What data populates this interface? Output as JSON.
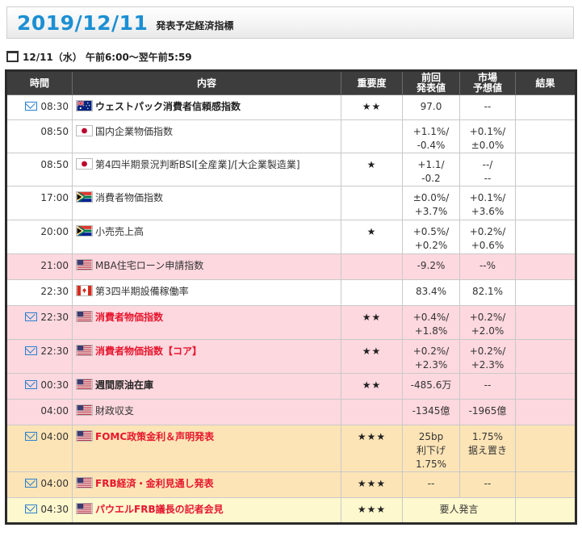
{
  "header": {
    "date": "2019/12/11",
    "subtitle": "発表予定経済指標"
  },
  "dayline": {
    "text": "12/11（水） 午前6:00～翌午前5:59"
  },
  "columns": {
    "time": "時間",
    "content": "内容",
    "importance": "重要度",
    "previous_l1": "前回",
    "previous_l2": "発表値",
    "forecast_l1": "市場",
    "forecast_l2": "予想値",
    "result": "結果"
  },
  "rows": [
    {
      "time": "08:30",
      "mail": true,
      "flag": "australia-flag-icon",
      "name": "ウェストパック消費者信頼感指数",
      "style": "bold",
      "bg": "white",
      "stars": "★★",
      "prev1": "97.0",
      "prev2": "",
      "prev3": "",
      "fore1": "--",
      "fore2": "",
      "result": ""
    },
    {
      "time": "08:50",
      "mail": false,
      "flag": "japan-flag-icon",
      "name": "国内企業物価指数",
      "style": "normal",
      "bg": "white",
      "stars": "",
      "prev1": "+1.1%/",
      "prev2": "-0.4%",
      "prev3": "",
      "fore1": "+0.1%/",
      "fore2": "±0.0%",
      "result": ""
    },
    {
      "time": "08:50",
      "mail": false,
      "flag": "japan-flag-icon",
      "name": "第4四半期景況判断BSI[全産業]/[大企業製造業]",
      "style": "normal",
      "bg": "white",
      "stars": "★",
      "prev1": "+1.1/",
      "prev2": "-0.2",
      "prev3": "",
      "fore1": "--/",
      "fore2": "--",
      "result": ""
    },
    {
      "time": "17:00",
      "mail": false,
      "flag": "south-africa-flag-icon",
      "name": "消費者物価指数",
      "style": "normal",
      "bg": "white",
      "stars": "",
      "prev1": "±0.0%/",
      "prev2": "+3.7%",
      "prev3": "",
      "fore1": "+0.1%/",
      "fore2": "+3.6%",
      "result": ""
    },
    {
      "time": "20:00",
      "mail": false,
      "flag": "south-africa-flag-icon",
      "name": "小売売上高",
      "style": "normal",
      "bg": "white",
      "stars": "★",
      "prev1": "+0.5%/",
      "prev2": "+0.2%",
      "prev3": "",
      "fore1": "+0.2%/",
      "fore2": "+0.6%",
      "result": ""
    },
    {
      "time": "21:00",
      "mail": false,
      "flag": "usa-flag-icon",
      "name": "MBA住宅ローン申請指数",
      "style": "normal",
      "bg": "pink",
      "stars": "",
      "prev1": "-9.2%",
      "prev2": "",
      "prev3": "",
      "fore1": "--%",
      "fore2": "",
      "result": ""
    },
    {
      "time": "22:30",
      "mail": false,
      "flag": "canada-flag-icon",
      "name": "第3四半期設備稼働率",
      "style": "normal",
      "bg": "white",
      "stars": "",
      "prev1": "83.4%",
      "prev2": "",
      "prev3": "",
      "fore1": "82.1%",
      "fore2": "",
      "result": ""
    },
    {
      "time": "22:30",
      "mail": true,
      "flag": "usa-flag-icon",
      "name": "消費者物価指数",
      "style": "red",
      "bg": "pink",
      "stars": "★★",
      "prev1": "+0.4%/",
      "prev2": "+1.8%",
      "prev3": "",
      "fore1": "+0.2%/",
      "fore2": "+2.0%",
      "result": ""
    },
    {
      "time": "22:30",
      "mail": true,
      "flag": "usa-flag-icon",
      "name": "消費者物価指数【コア】",
      "style": "red",
      "bg": "pink",
      "stars": "★★",
      "prev1": "+0.2%/",
      "prev2": "+2.3%",
      "prev3": "",
      "fore1": "+0.2%/",
      "fore2": "+2.3%",
      "result": ""
    },
    {
      "time": "00:30",
      "mail": true,
      "flag": "usa-flag-icon",
      "name": "週間原油在庫",
      "style": "bold",
      "bg": "pink",
      "stars": "★★",
      "prev1": "-485.6万",
      "prev2": "",
      "prev3": "",
      "fore1": "--",
      "fore2": "",
      "result": ""
    },
    {
      "time": "04:00",
      "mail": false,
      "flag": "usa-flag-icon",
      "name": "財政収支",
      "style": "normal",
      "bg": "pink",
      "stars": "",
      "prev1": "-1345億",
      "prev2": "",
      "prev3": "",
      "fore1": "-1965億",
      "fore2": "",
      "result": ""
    },
    {
      "time": "04:00",
      "mail": true,
      "flag": "usa-flag-icon",
      "name": "FOMC政策金利＆声明発表",
      "style": "red",
      "bg": "orange",
      "stars": "★★★",
      "prev1": "25bp",
      "prev2": "利下げ",
      "prev3": "1.75%",
      "fore1": "1.75%",
      "fore2": "据え置き",
      "result": ""
    },
    {
      "time": "04:00",
      "mail": true,
      "flag": "usa-flag-icon",
      "name": "FRB経済・金利見通し発表",
      "style": "red",
      "bg": "orange",
      "stars": "★★★",
      "prev1": "--",
      "prev2": "",
      "prev3": "",
      "fore1": "--",
      "fore2": "",
      "result": ""
    },
    {
      "time": "04:30",
      "mail": true,
      "flag": "usa-flag-icon",
      "name": "パウエルFRB議長の記者会見",
      "style": "red",
      "bg": "yellow",
      "stars": "★★★",
      "merged": "要人発言",
      "result": ""
    }
  ],
  "colors": {
    "title": "#1c8fd3",
    "header_bg": "#3d3d3d",
    "pink_row": "#fed8df",
    "orange_row": "#fde4b6",
    "yellow_row": "#fef8ce",
    "red_text": "#e6172e",
    "mail_icon": "#2a7fd0"
  }
}
